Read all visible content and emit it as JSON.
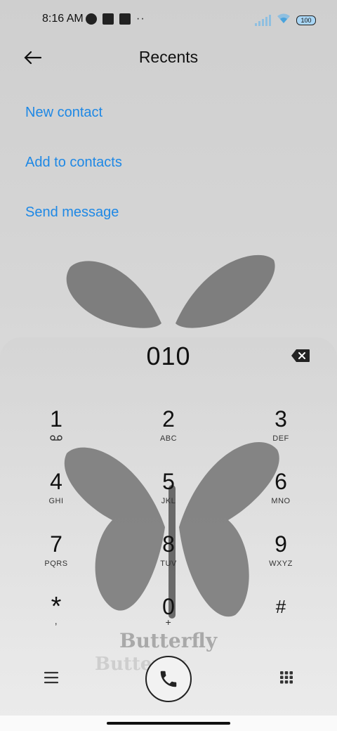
{
  "status": {
    "time": "8:16 AM",
    "battery": "100"
  },
  "header": {
    "title": "Recents"
  },
  "actions": [
    "New contact",
    "Add to contacts",
    "Send message"
  ],
  "dialer": {
    "number": "010",
    "keys": [
      {
        "digit": "1",
        "letters": ""
      },
      {
        "digit": "2",
        "letters": "ABC"
      },
      {
        "digit": "3",
        "letters": "DEF"
      },
      {
        "digit": "4",
        "letters": "GHI"
      },
      {
        "digit": "5",
        "letters": "JKL"
      },
      {
        "digit": "6",
        "letters": "MNO"
      },
      {
        "digit": "7",
        "letters": "PQRS"
      },
      {
        "digit": "8",
        "letters": "TUV"
      },
      {
        "digit": "9",
        "letters": "WXYZ"
      },
      {
        "digit": "*",
        "letters": ","
      },
      {
        "digit": "0",
        "letters": "+"
      },
      {
        "digit": "#",
        "letters": ""
      }
    ]
  },
  "wallpaper": {
    "watermark": "Butterfly",
    "watermark_echo": "Butterfly"
  },
  "icons": [
    "back-arrow-icon",
    "voicemail-icon",
    "delete-icon",
    "menu-icon",
    "phone-icon",
    "keypad-icon",
    "wifi-icon",
    "signal-icon"
  ],
  "colors": {
    "accent": "#1e88e5",
    "text": "#111111"
  }
}
